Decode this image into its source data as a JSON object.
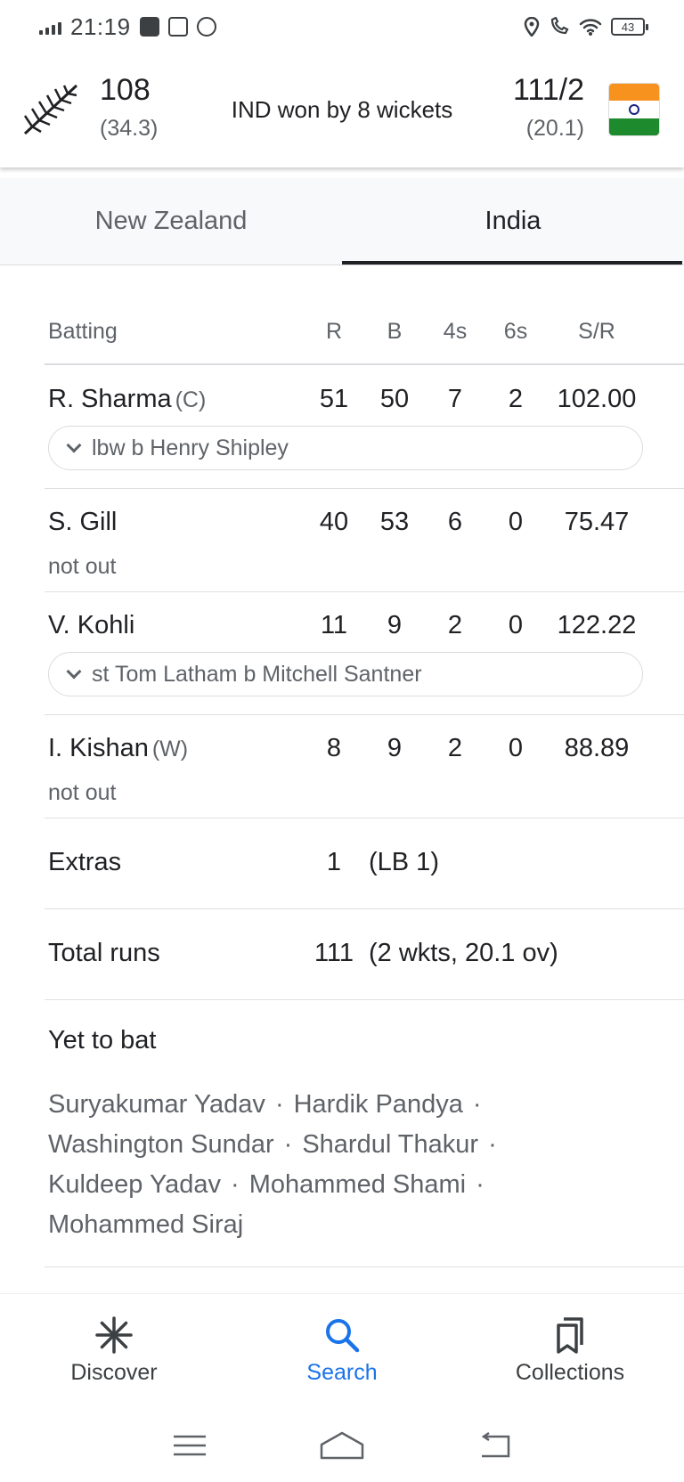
{
  "status_bar": {
    "time": "21:19",
    "battery": "43"
  },
  "match": {
    "team1": {
      "name": "New Zealand",
      "score": "108",
      "overs": "(34.3)"
    },
    "team2": {
      "name": "India",
      "score": "111/2",
      "overs": "(20.1)"
    },
    "result": "IND won by 8 wickets"
  },
  "tabs": [
    {
      "label": "New Zealand",
      "active": false
    },
    {
      "label": "India",
      "active": true
    }
  ],
  "batting": {
    "headers": {
      "name": "Batting",
      "r": "R",
      "b": "B",
      "fours": "4s",
      "sixes": "6s",
      "sr": "S/R"
    },
    "rows": [
      {
        "name": "R. Sharma",
        "role": "(C)",
        "r": "51",
        "b": "50",
        "fours": "7",
        "sixes": "2",
        "sr": "102.00",
        "dismissal": "lbw b Henry Shipley"
      },
      {
        "name": "S. Gill",
        "role": "",
        "r": "40",
        "b": "53",
        "fours": "6",
        "sixes": "0",
        "sr": "75.47",
        "dismissal": "not out"
      },
      {
        "name": "V. Kohli",
        "role": "",
        "r": "11",
        "b": "9",
        "fours": "2",
        "sixes": "0",
        "sr": "122.22",
        "dismissal": "st Tom Latham b Mitchell Santner"
      },
      {
        "name": "I. Kishan",
        "role": "(W)",
        "r": "8",
        "b": "9",
        "fours": "2",
        "sixes": "0",
        "sr": "88.89",
        "dismissal": "not out"
      }
    ],
    "extras": {
      "label": "Extras",
      "value": "1",
      "note": "(LB 1)"
    },
    "total": {
      "label": "Total runs",
      "value": "111",
      "note": "(2 wkts, 20.1 ov)"
    }
  },
  "yet_to_bat": {
    "title": "Yet to bat",
    "players": [
      "Suryakumar Yadav",
      "Hardik Pandya",
      "Washington Sundar",
      "Shardul Thakur",
      "Kuldeep Yadav",
      "Mohammed Shami",
      "Mohammed Siraj"
    ]
  },
  "bottom_nav": [
    {
      "label": "Discover",
      "icon": "asterisk-icon",
      "active": false
    },
    {
      "label": "Search",
      "icon": "search-icon",
      "active": true
    },
    {
      "label": "Collections",
      "icon": "collections-icon",
      "active": false
    }
  ],
  "colors": {
    "accent": "#1a73e8",
    "text": "#202124",
    "muted": "#5f6368"
  }
}
